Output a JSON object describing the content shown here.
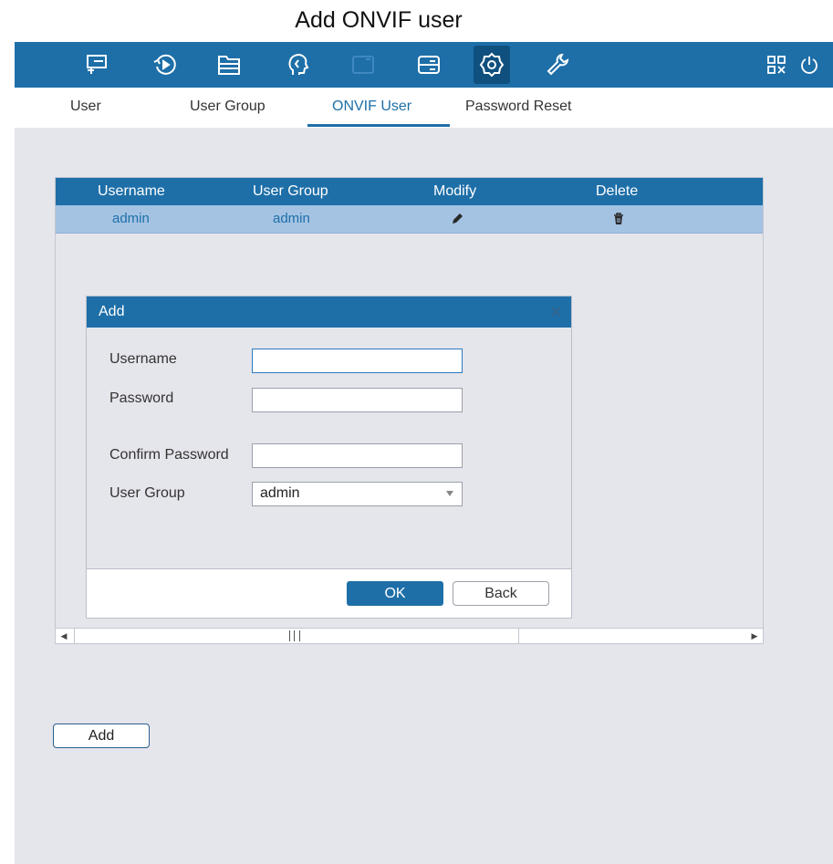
{
  "page_title": "Add ONVIF user",
  "toolbar": {
    "icons": [
      "monitor-icon",
      "playback-icon",
      "file-icon",
      "ai-head-icon",
      "camera-icon",
      "storage-icon",
      "settings-icon",
      "maintenance-icon"
    ],
    "active_icon": "settings-icon",
    "right_icons": [
      "qr-code-icon",
      "power-icon"
    ]
  },
  "tabs": [
    {
      "label": "User"
    },
    {
      "label": "User Group"
    },
    {
      "label": "ONVIF User",
      "active": true
    },
    {
      "label": "Password Reset"
    }
  ],
  "table": {
    "columns": [
      "Username",
      "User Group",
      "Modify",
      "Delete"
    ],
    "rows": [
      {
        "username": "admin",
        "user_group": "admin",
        "modify_icon": "pencil-icon",
        "delete_icon": "trash-icon"
      }
    ]
  },
  "dialog": {
    "title": "Add",
    "close_icon": "close-icon",
    "fields": {
      "username_label": "Username",
      "username_value": "",
      "password_label": "Password",
      "password_value": "",
      "confirm_password_label": "Confirm Password",
      "confirm_password_value": "",
      "user_group_label": "User Group",
      "user_group_value": "admin"
    },
    "ok_label": "OK",
    "back_label": "Back"
  },
  "add_button_label": "Add",
  "colors": {
    "primary": "#1e6fa8",
    "selected_row": "#a4c3e3",
    "background": "#e5e5ec"
  }
}
